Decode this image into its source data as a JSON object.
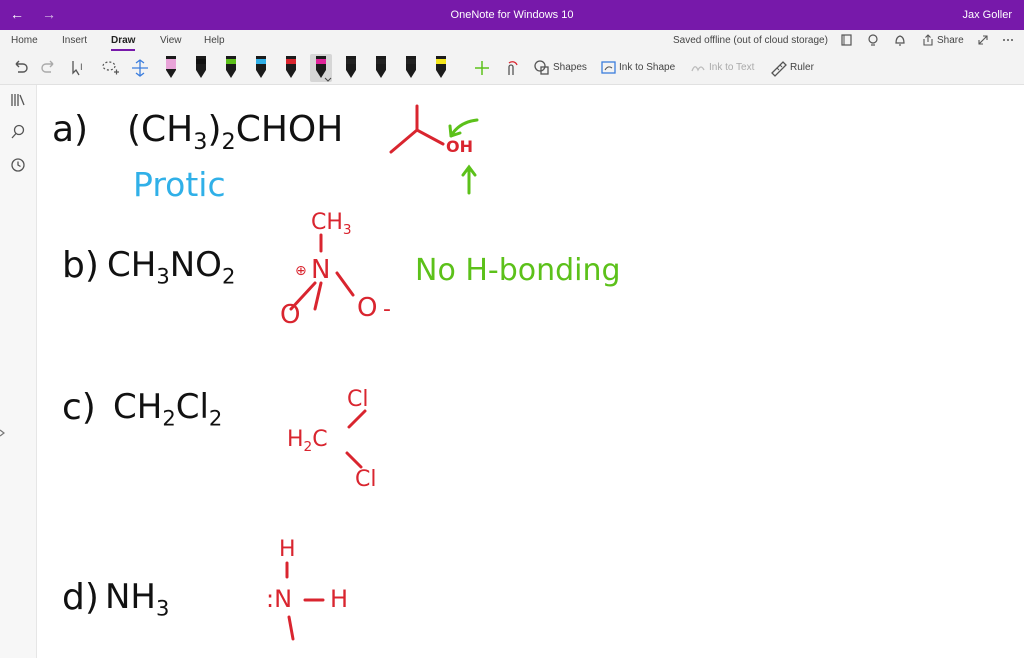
{
  "window": {
    "title": "OneNote for Windows 10",
    "user": "Jax Goller"
  },
  "ribbon": {
    "tabs": [
      "Home",
      "Insert",
      "Draw",
      "View",
      "Help"
    ],
    "active_tab": "Draw",
    "status": "Saved offline (out of cloud storage)",
    "share_label": "Share",
    "tools": {
      "shapes": "Shapes",
      "ink_to_shape": "Ink to Shape",
      "ink_to_text": "Ink to Text",
      "ruler": "Ruler"
    }
  },
  "pens": [
    {
      "name": "pen-pink-highlight",
      "color": "#e8a3d8"
    },
    {
      "name": "pen-black",
      "color": "#111111"
    },
    {
      "name": "pen-green",
      "color": "#5cc11a"
    },
    {
      "name": "pen-blue",
      "color": "#30b0e8"
    },
    {
      "name": "pen-red",
      "color": "#d9252f"
    },
    {
      "name": "pen-magenta",
      "color": "#e0249a"
    },
    {
      "name": "pen-black-2",
      "color": "#222222"
    },
    {
      "name": "pen-black-3",
      "color": "#222222"
    },
    {
      "name": "pen-black-4",
      "color": "#222222"
    },
    {
      "name": "highlighter-yellow",
      "color": "#f3e51b"
    }
  ],
  "notes": {
    "a": {
      "label": "a)",
      "formula": "(CH",
      "formula_sub": "3",
      "formula_mid": ")",
      "formula_sub2": "2",
      "formula_end": "CHOH",
      "classification": "Protic",
      "oh": "OH"
    },
    "b": {
      "label": "b)",
      "formula": "CH",
      "formula_sub": "3",
      "formula_mid": "NO",
      "formula_sub2": "2",
      "ch3": "CH",
      "ch3_sub": "3",
      "n": "N",
      "o1": "O",
      "o2": "O",
      "plus": "⊕",
      "minus": "-",
      "note": "No H-bonding"
    },
    "c": {
      "label": "c)",
      "formula": "CH",
      "formula_sub": "2",
      "formula_mid": "Cl",
      "formula_sub2": "2",
      "cl1": "Cl",
      "cl2": "Cl",
      "h2c": "H",
      "h2c_sub": "2",
      "h2c_c": "C"
    },
    "d": {
      "label": "d)",
      "formula": "NH",
      "formula_sub": "3",
      "h_top": "H",
      "n": ":N",
      "h_right": "H"
    }
  }
}
